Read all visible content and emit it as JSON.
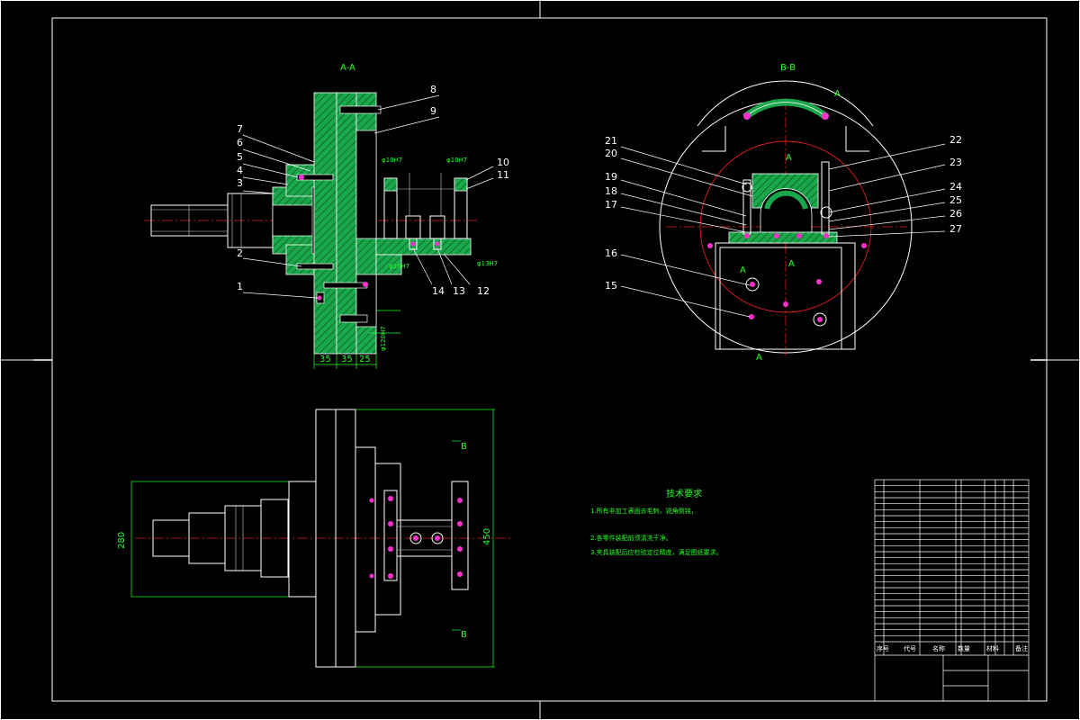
{
  "drawing": {
    "section_aa_title": "A-A",
    "section_bb_title": "B-B",
    "view_a_label": "A",
    "view_b_label": "B",
    "part_numbers_left": [
      "1",
      "2",
      "3",
      "4",
      "5",
      "6",
      "7",
      "8",
      "9",
      "10",
      "11",
      "12",
      "13",
      "14"
    ],
    "part_numbers_right": [
      "15",
      "16",
      "17",
      "18",
      "19",
      "20",
      "21",
      "22",
      "23",
      "24",
      "25",
      "26",
      "27"
    ],
    "dimensions": {
      "d1": "35",
      "d2": "35",
      "d3": "25",
      "height_front": "280",
      "height_right": "450"
    },
    "tech_requirements": {
      "title": "技术要求",
      "lines": [
        "1.所有非加工表面去毛刺，锐角倒钝，",
        "2.各零件装配前须清洗干净。",
        "3.夹具装配后应检验定位精度，满足图纸要求。"
      ]
    },
    "title_block": {
      "header_labels": [
        "序号",
        "代号",
        "名称",
        "数量",
        "材料",
        "备注"
      ]
    }
  }
}
